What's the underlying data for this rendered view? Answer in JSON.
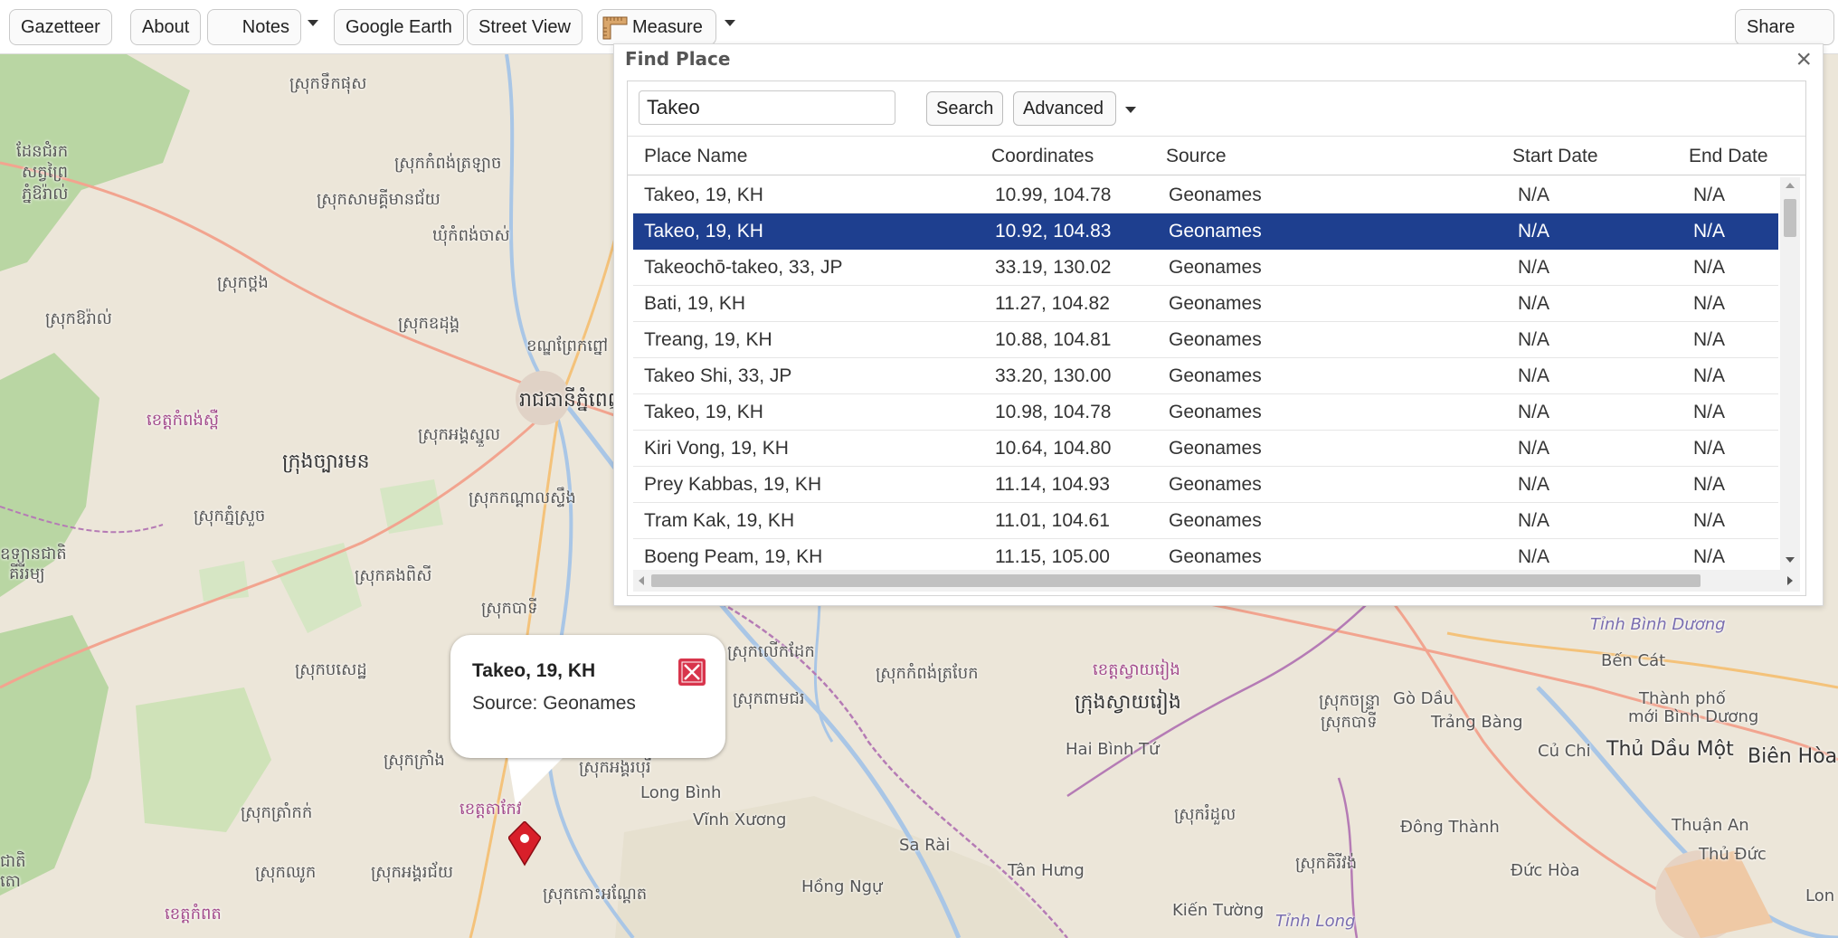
{
  "toolbar": {
    "gazetteer": "Gazetteer",
    "about": "About",
    "notes": "Notes",
    "google_earth": "Google Earth",
    "street_view": "Street View",
    "measure": "Measure",
    "share_map": "Share Map"
  },
  "find_place": {
    "title": "Find Place",
    "close": "×",
    "search_value": "Takeo",
    "search_button": "Search",
    "advanced_button": "Advanced",
    "columns": [
      "Place Name",
      "Coordinates",
      "Source",
      "Start Date",
      "End Date"
    ],
    "rows": [
      {
        "name": "Takeo, 19, KH",
        "coords": "10.99, 104.78",
        "source": "Geonames",
        "start": "N/A",
        "end": "N/A"
      },
      {
        "name": "Takeo, 19, KH",
        "coords": "10.92, 104.83",
        "source": "Geonames",
        "start": "N/A",
        "end": "N/A"
      },
      {
        "name": "Takeochō-takeo, 33, JP",
        "coords": "33.19, 130.02",
        "source": "Geonames",
        "start": "N/A",
        "end": "N/A"
      },
      {
        "name": "Bati, 19, KH",
        "coords": "11.27, 104.82",
        "source": "Geonames",
        "start": "N/A",
        "end": "N/A"
      },
      {
        "name": "Treang, 19, KH",
        "coords": "10.88, 104.81",
        "source": "Geonames",
        "start": "N/A",
        "end": "N/A"
      },
      {
        "name": "Takeo Shi, 33, JP",
        "coords": "33.20, 130.00",
        "source": "Geonames",
        "start": "N/A",
        "end": "N/A"
      },
      {
        "name": "Takeo, 19, KH",
        "coords": "10.98, 104.78",
        "source": "Geonames",
        "start": "N/A",
        "end": "N/A"
      },
      {
        "name": "Kiri Vong, 19, KH",
        "coords": "10.64, 104.80",
        "source": "Geonames",
        "start": "N/A",
        "end": "N/A"
      },
      {
        "name": "Prey Kabbas, 19, KH",
        "coords": "11.14, 104.93",
        "source": "Geonames",
        "start": "N/A",
        "end": "N/A"
      },
      {
        "name": "Tram Kak, 19, KH",
        "coords": "11.01, 104.61",
        "source": "Geonames",
        "start": "N/A",
        "end": "N/A"
      },
      {
        "name": "Boeng Peam, 19, KH",
        "coords": "11.15, 105.00",
        "source": "Geonames",
        "start": "N/A",
        "end": "N/A"
      }
    ],
    "selected_index": 1
  },
  "popup": {
    "title": "Takeo, 19, KH",
    "source": "Source: Geonames"
  },
  "map_labels": [
    {
      "text": "ស្រុកទឹកផុស",
      "style": ""
    },
    {
      "text": "ដែនជំរក",
      "style": ""
    },
    {
      "text": "សត្វព្រៃ",
      "style": ""
    },
    {
      "text": "ភ្នំឱរ៉ាល់",
      "style": ""
    },
    {
      "text": "ស្រុកកំពង់ត្រឡាច",
      "style": ""
    },
    {
      "text": "ស្រុកសាមគ្គីមានជ័យ",
      "style": ""
    },
    {
      "text": "ឃុំកំពង់ចាស់",
      "style": ""
    },
    {
      "text": "ស្រុកថ្ពង",
      "style": ""
    },
    {
      "text": "ស្រុកឱរ៉ាល់",
      "style": ""
    },
    {
      "text": "ស្រុកឧដុង្គ",
      "style": ""
    },
    {
      "text": "ខណ្ឌព្រែកព្នៅ",
      "style": ""
    },
    {
      "text": "ខេត្តកំពង់ស្ពឺ",
      "style": "purple"
    },
    {
      "text": "រាជធានីភ្នំពេញ",
      "style": "big"
    },
    {
      "text": "ស្រុកអង្គស្នួល",
      "style": ""
    },
    {
      "text": "ក្រុងច្បារមន",
      "style": "big"
    },
    {
      "text": "ស្រុកកណ្តាលស្ទឹង",
      "style": ""
    },
    {
      "text": "ស្រុកភ្នំស្រួច",
      "style": ""
    },
    {
      "text": "ឧទ្យានជាតិ",
      "style": ""
    },
    {
      "text": "គីរីរម្យ",
      "style": ""
    },
    {
      "text": "ស្រុកគងពិសី",
      "style": ""
    },
    {
      "text": "ស្រុកបាទី",
      "style": ""
    },
    {
      "text": "ស្រុកបសេដ្ឋ",
      "style": ""
    },
    {
      "text": "ស្រុកលើកដែក",
      "style": ""
    },
    {
      "text": "ស្រុកកំពង់ត្របែក",
      "style": ""
    },
    {
      "text": "ស្រុកពាមជរ",
      "style": ""
    },
    {
      "text": "ខេត្តស្វាយរៀង",
      "style": "purple"
    },
    {
      "text": "ក្រុងស្វាយរៀង",
      "style": "big"
    },
    {
      "text": "ស្រុកចន្ទ្រា",
      "style": ""
    },
    {
      "text": "Gò Dầu",
      "style": ""
    },
    {
      "text": "Tỉnh Bình Dương",
      "style": "italic"
    },
    {
      "text": "Bến Cát",
      "style": ""
    },
    {
      "text": "Thành phố",
      "style": ""
    },
    {
      "text": "mới Bình Dương",
      "style": ""
    },
    {
      "text": "Trảng Bàng",
      "style": ""
    },
    {
      "text": "Củ Chi",
      "style": ""
    },
    {
      "text": "Thủ Dầu Một",
      "style": "big"
    },
    {
      "text": "Biên Hòa",
      "style": "big"
    },
    {
      "text": "Hai Bình Tứ",
      "style": ""
    },
    {
      "text": "ស្រុកក្រាំង",
      "style": ""
    },
    {
      "text": "ស្រុកត្រាំកក់",
      "style": ""
    },
    {
      "text": "ស្រុកអង្គរបុរី",
      "style": ""
    },
    {
      "text": "ខេត្តតាកែវ",
      "style": "purple"
    },
    {
      "text": "Long Bình",
      "style": ""
    },
    {
      "text": "Vĩnh Xương",
      "style": ""
    },
    {
      "text": "ស្រុករំដួល",
      "style": ""
    },
    {
      "text": "Đông Thành",
      "style": ""
    },
    {
      "text": "Thuận An",
      "style": ""
    },
    {
      "text": "Thủ Đức",
      "style": ""
    },
    {
      "text": "ស្រុកគិរីវង់",
      "style": ""
    },
    {
      "text": "Sa Rài",
      "style": ""
    },
    {
      "text": "Đức Hòa",
      "style": ""
    },
    {
      "text": "ស្រុកឈូក",
      "style": ""
    },
    {
      "text": "ស្រុកអង្គរជ័យ",
      "style": ""
    },
    {
      "text": "Tân Hưng",
      "style": ""
    },
    {
      "text": "Hồng Ngự",
      "style": ""
    },
    {
      "text": "ស្រុកកោះអណ្តែត",
      "style": ""
    },
    {
      "text": "Kiến Tường",
      "style": ""
    },
    {
      "text": "Tỉnh Long",
      "style": "italic"
    },
    {
      "text": "ខេត្តកំពត",
      "style": "purple"
    },
    {
      "text": "ជាតិ",
      "style": ""
    },
    {
      "text": "តោ",
      "style": ""
    },
    {
      "text": "Lon",
      "style": ""
    },
    {
      "text": "ស្រុកបាទី",
      "style": ""
    }
  ]
}
